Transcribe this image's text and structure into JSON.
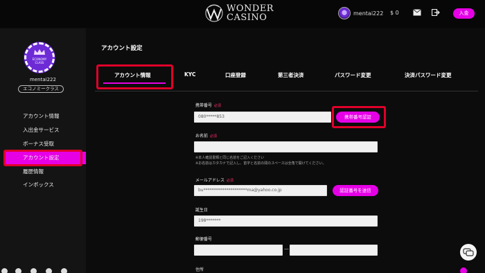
{
  "header": {
    "logo_line1": "WONDER",
    "logo_line2": "CASINO",
    "username": "mentai222",
    "balance": "$ 0",
    "deposit_label": "入金"
  },
  "sidebar": {
    "username": "mentai222",
    "class_label": "エコノミークラス",
    "avatar_text": "ECONOMY CLASS",
    "items": [
      {
        "label": "アカウント情報",
        "active": false
      },
      {
        "label": "入出金サービス",
        "active": false
      },
      {
        "label": "ボーナス受取",
        "active": false
      },
      {
        "label": "アカウント設定",
        "active": true
      },
      {
        "label": "履歴情報",
        "active": false
      },
      {
        "label": "インボックス",
        "active": false
      }
    ]
  },
  "main": {
    "page_title": "アカウント設定",
    "tabs": [
      {
        "label": "アカウント情報",
        "active": true
      },
      {
        "label": "KYC"
      },
      {
        "label": "口座登録"
      },
      {
        "label": "第三者決済"
      },
      {
        "label": "パスワード変更"
      },
      {
        "label": "決済パスワード変更"
      }
    ]
  },
  "form": {
    "phone_label": "携帯番号",
    "required": "必須",
    "phone_value": "080*****853",
    "phone_verify_button": "携帯番号認証",
    "name_label": "お名前",
    "name_value": "",
    "name_note1": "※本人確認書類と同じ名前をご記入ください",
    "name_note2": "※お名前はカタカナで記入し、苗字と名前の間のスペースは全角で開けてください。",
    "email_label": "メールアドレス",
    "email_value": "bu*********************ma@yahoo.co.jp",
    "email_verify_button": "認証番号を送信",
    "birth_label": "誕生日",
    "birth_value": "198*******",
    "postal_label": "郵便番号",
    "postal_dash": "—",
    "address_label": "住所"
  },
  "colors": {
    "accent": "#e600e6",
    "highlight": "#e0002a",
    "background": "#0b0b0b"
  }
}
